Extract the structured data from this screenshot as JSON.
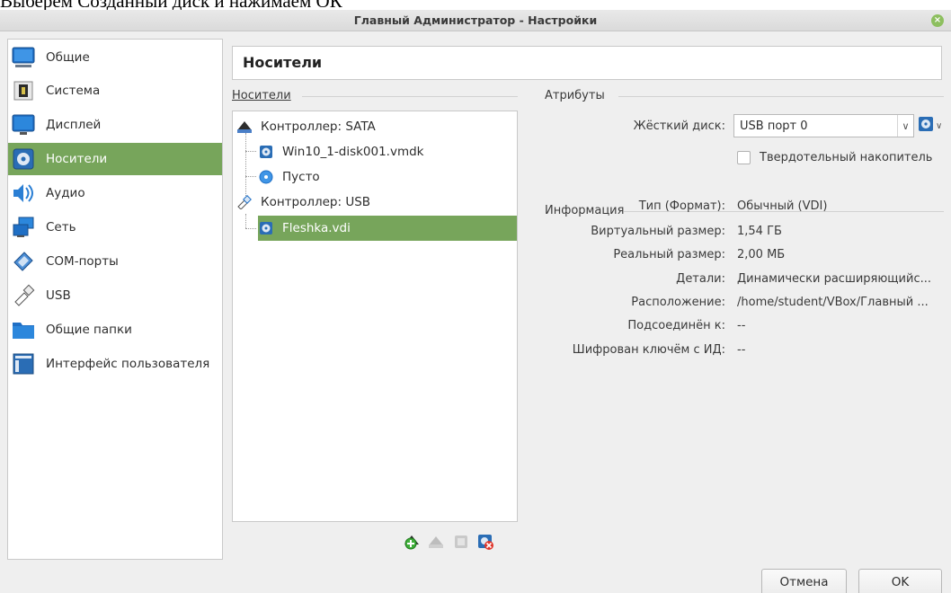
{
  "caption": "Выберем Созданный диск и нажимаем ОК",
  "window": {
    "title": "Главный Администратор - Настройки",
    "close_icon": "close-icon"
  },
  "sidebar": {
    "selected_index": 3,
    "items": [
      {
        "label": "Общие",
        "icon": "monitor-icon"
      },
      {
        "label": "Система",
        "icon": "chip-icon"
      },
      {
        "label": "Дисплей",
        "icon": "display-icon"
      },
      {
        "label": "Носители",
        "icon": "storage-icon"
      },
      {
        "label": "Аудио",
        "icon": "audio-icon"
      },
      {
        "label": "Сеть",
        "icon": "network-icon"
      },
      {
        "label": "COM-порты",
        "icon": "serial-port-icon"
      },
      {
        "label": "USB",
        "icon": "usb-icon"
      },
      {
        "label": "Общие папки",
        "icon": "folder-icon"
      },
      {
        "label": "Интерфейс пользователя",
        "icon": "user-interface-icon"
      }
    ]
  },
  "page_title": "Носители",
  "storage": {
    "label": "Носители",
    "tree": {
      "controllers": [
        {
          "label": "Контроллер: SATA",
          "icon": "sata-controller-icon",
          "children": [
            {
              "label": "Win10_1-disk001.vmdk",
              "icon": "hard-disk-icon"
            },
            {
              "label": "Пусто",
              "icon": "optical-disc-icon"
            }
          ]
        },
        {
          "label": "Контроллер: USB",
          "icon": "usb-controller-icon",
          "children": [
            {
              "label": "Fleshka.vdi",
              "icon": "hard-disk-icon",
              "selected": true
            }
          ]
        }
      ]
    },
    "toolbar_icons": [
      "add-controller-icon",
      "remove-controller-icon",
      "add-attachment-icon",
      "remove-attachment-icon"
    ]
  },
  "attributes": {
    "label": "Атрибуты",
    "hard_disk_label": "Жёсткий диск:",
    "hard_disk_value": "USB порт 0",
    "ssd_label": "Твердотельный накопитель",
    "ssd_checked": false
  },
  "information": {
    "label": "Информация",
    "rows": [
      {
        "key": "Тип (Формат):",
        "value": "Обычный (VDI)"
      },
      {
        "key": "Виртуальный размер:",
        "value": "1,54 ГБ"
      },
      {
        "key": "Реальный размер:",
        "value": "2,00 МБ"
      },
      {
        "key": "Детали:",
        "value": "Динамически расширяющийс..."
      },
      {
        "key": "Расположение:",
        "value": "/home/student/VBox/Главный ..."
      },
      {
        "key": "Подсоединён к:",
        "value": "--"
      },
      {
        "key": "Шифрован ключём с ИД:",
        "value": "--"
      }
    ]
  },
  "buttons": {
    "cancel": "Отмена",
    "ok": "OK"
  },
  "colors": {
    "selection": "#77a55b",
    "background": "#efefef"
  }
}
